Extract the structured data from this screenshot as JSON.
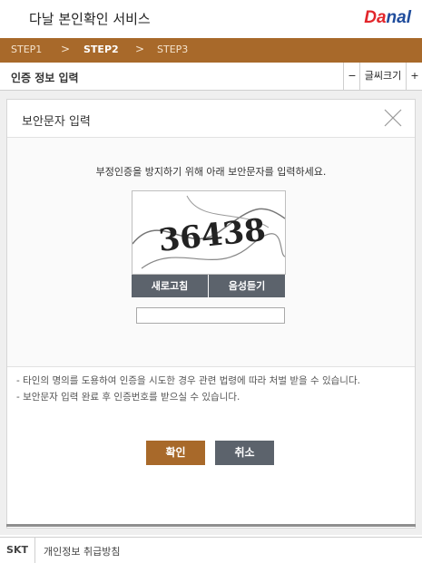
{
  "header": {
    "title": "다날 본인확인 서비스",
    "logo_part1": "Da",
    "logo_part2": "nal"
  },
  "steps": {
    "items": [
      "STEP1",
      "STEP2",
      "STEP3"
    ],
    "separators": [
      ">",
      ">"
    ],
    "active_index": 1
  },
  "toolbar": {
    "title": "인증 정보 입력",
    "decrease": "−",
    "font_size": "글씨크기",
    "increase": "+"
  },
  "dialog": {
    "title": "보안문자 입력",
    "instruction": "부정인증을 방지하기 위해 아래 보안문자를 입력하세요.",
    "captcha_text": "36438",
    "refresh_label": "새로고침",
    "audio_label": "음성듣기",
    "input_value": "",
    "notes": [
      "- 타인의 명의를 도용하여 인증을 시도한 경우 관련 법령에 따라 처벌 받을 수 있습니다.",
      "- 보안문자 입력 완료 후 인증번호를 받으실 수 있습니다."
    ],
    "confirm_label": "확인",
    "cancel_label": "취소"
  },
  "footer": {
    "carrier": "SKT",
    "privacy": "개인정보 취급방침"
  },
  "colors": {
    "accent": "#a8692a",
    "button_gray": "#5c636c",
    "logo_red": "#e2262b",
    "logo_blue": "#1f4c9c"
  }
}
